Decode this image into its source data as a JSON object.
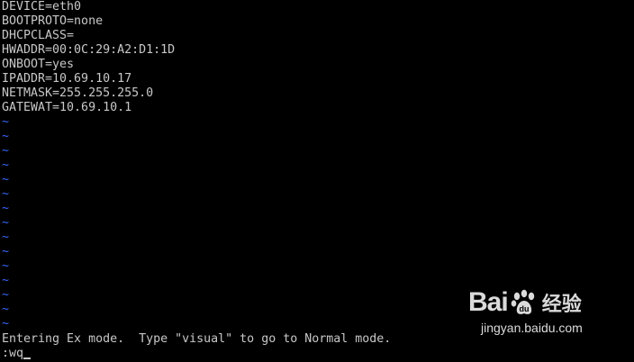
{
  "editor": {
    "lines": [
      "DEVICE=eth0",
      "BOOTPROTO=none",
      "DHCPCLASS=",
      "HWADDR=00:0C:29:A2:D1:1D",
      "ONBOOT=yes",
      "IPADDR=10.69.10.17",
      "NETMASK=255.255.255.0",
      "GATEWAT=10.69.10.1"
    ],
    "empty_line_marker": "~",
    "status_message": "Entering Ex mode.  Type \"visual\" to go to Normal mode.",
    "command_line": ":wq"
  },
  "watermark": {
    "brand_left": "Bai",
    "brand_right": "du",
    "brand_suffix": "经验",
    "url": "jingyan.baidu.com",
    "icon": "baidu-paw-icon"
  },
  "colors": {
    "background": "#000000",
    "text": "#c8c8c8",
    "tilde": "#3a66ff"
  }
}
